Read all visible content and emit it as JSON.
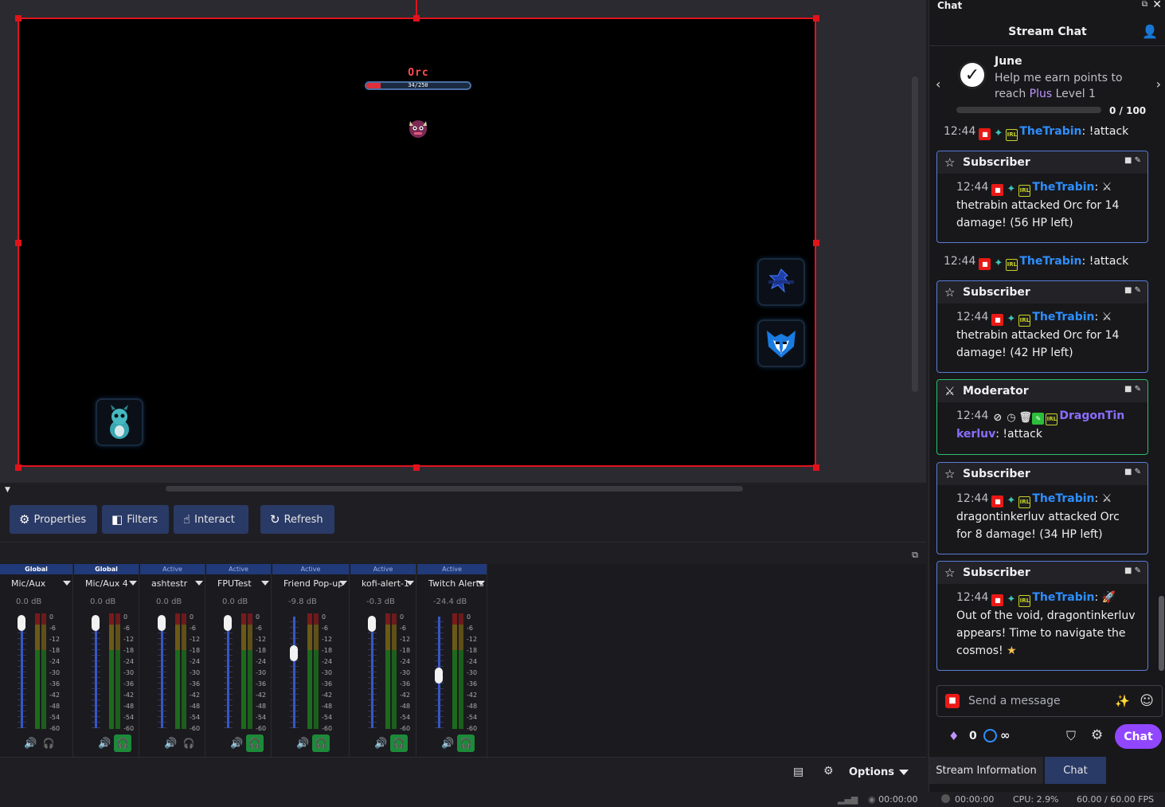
{
  "canvas": {
    "enemy_name": "Orc",
    "enemy_hp_text": "34/250",
    "enemy_hp_fraction": 0.136
  },
  "toolbar": {
    "properties_label": "Properties",
    "filters_label": "Filters",
    "interact_label": "Interact",
    "refresh_label": "Refresh"
  },
  "mixer": {
    "channels": [
      {
        "tag": "Global",
        "name": "Mic/Aux",
        "db": "0.0 dB",
        "level": 1.0,
        "monitor": "off"
      },
      {
        "tag": "Global",
        "name": "Mic/Aux 4",
        "db": "0.0 dB",
        "level": 1.0,
        "monitor": "on"
      },
      {
        "tag": "Active",
        "name": "ashtestr",
        "db": "0.0 dB",
        "level": 1.0,
        "monitor": "off"
      },
      {
        "tag": "Active",
        "name": "FPUTest",
        "db": "0.0 dB",
        "level": 1.0,
        "monitor": "on"
      },
      {
        "tag": "Active",
        "name": "Friend Pop-up",
        "db": "-9.8 dB",
        "level": 0.68,
        "monitor": "on"
      },
      {
        "tag": "Active",
        "name": "kofi-alert-1",
        "db": "-0.3 dB",
        "level": 0.99,
        "monitor": "on"
      },
      {
        "tag": "Active",
        "name": "Twitch Alerts",
        "db": "-24.4 dB",
        "level": 0.45,
        "monitor": "on"
      }
    ],
    "scale": [
      "0",
      "-6",
      "-12",
      "-18",
      "-24",
      "-30",
      "-36",
      "-42",
      "-48",
      "-54",
      "-60"
    ],
    "options_label": "Options"
  },
  "statusbar": {
    "stream_time": "00:00:00",
    "record_time": "00:00:00",
    "cpu": "CPU: 2.9%",
    "fps": "60.00 / 60.00 FPS"
  },
  "chat": {
    "dock_title": "Chat",
    "header_title": "Stream Chat",
    "goal": {
      "name": "June",
      "text_before": "Help me earn points to reach ",
      "text_plus": "Plus",
      "text_after": " Level 1",
      "count": "0 / 100",
      "progress": 0.0
    },
    "messages": [
      {
        "time": "12:44",
        "user": "TheTrabin",
        "text": "!attack"
      },
      {
        "header": "Subscriber",
        "time": "12:44",
        "user": "TheTrabin",
        "text": "thetrabin attacked Orc for 14 damage! (56 HP left)"
      },
      {
        "time": "12:44",
        "user": "TheTrabin",
        "text": "!attack"
      },
      {
        "header": "Subscriber",
        "time": "12:44",
        "user": "TheTrabin",
        "text": "thetrabin attacked Orc for 14 damage! (42 HP left)"
      },
      {
        "header": "Moderator",
        "time": "12:44",
        "user": "DragonTinkerluv",
        "user_part1": "DragonTin",
        "user_part2": "kerluv",
        "text": "!attack"
      },
      {
        "header": "Subscriber",
        "time": "12:44",
        "user": "TheTrabin",
        "text": "dragontinkerluv attacked Orc for 8 damage! (34 HP left)"
      },
      {
        "header": "Subscriber",
        "time": "12:44",
        "user": "TheTrabin",
        "text": "Out of the void, dragontinkerluv appears! Time to navigate the cosmos!"
      }
    ],
    "input_placeholder": "Send a message",
    "bits": "0",
    "points": "∞",
    "send_label": "Chat"
  },
  "dock_tabs": {
    "stream_info": "Stream Information",
    "chat": "Chat"
  }
}
